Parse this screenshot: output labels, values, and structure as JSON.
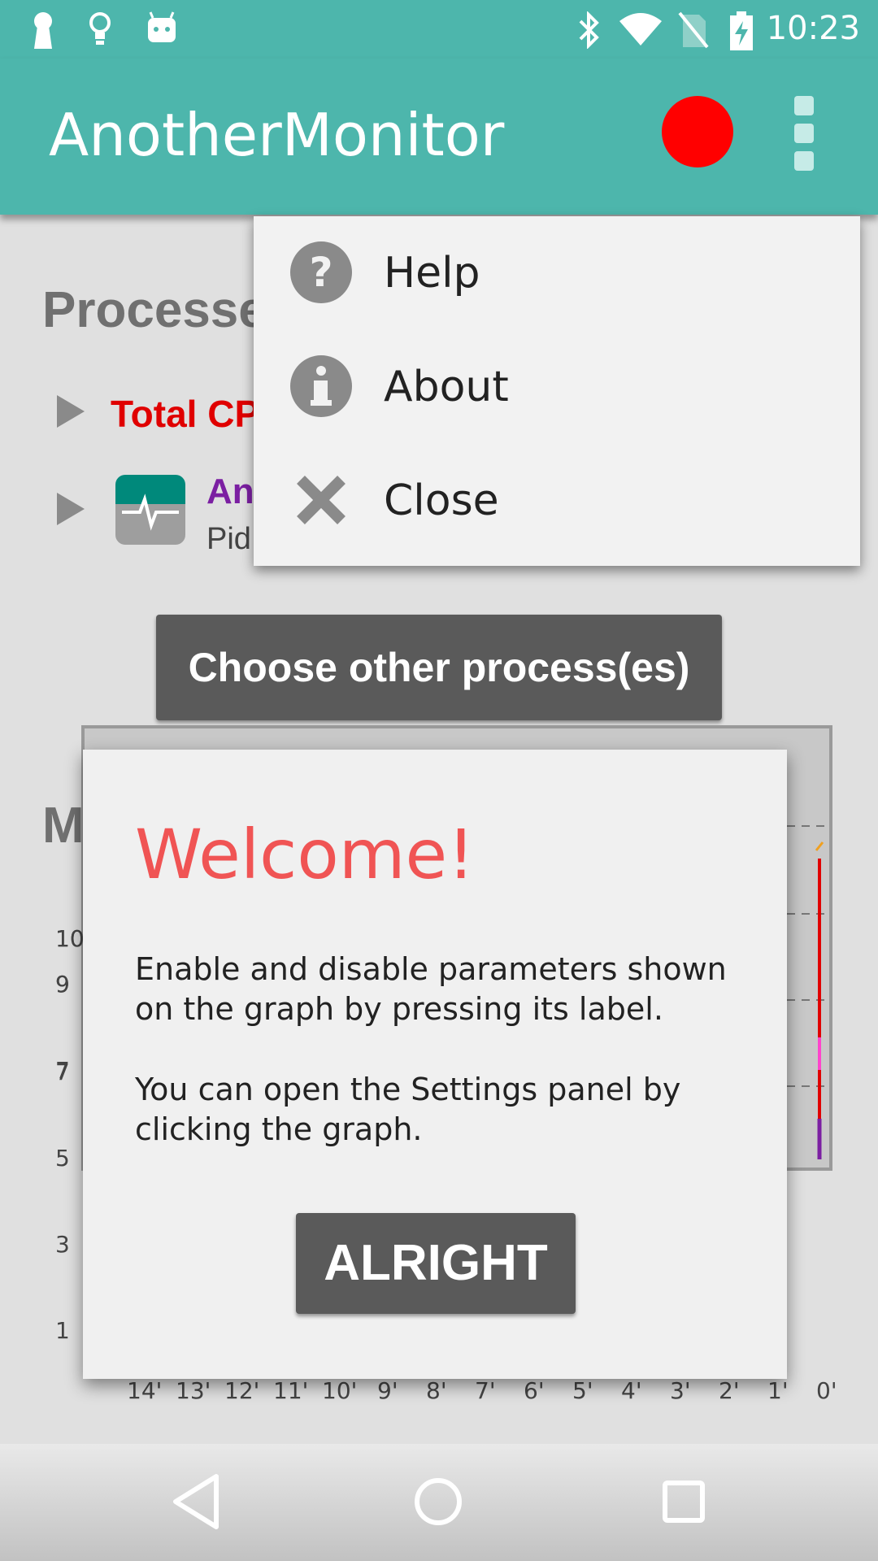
{
  "status_bar": {
    "time": "10:23",
    "left_icons": [
      "keyhole-icon",
      "lightbulb-icon",
      "android-icon"
    ],
    "right_icons": [
      "bluetooth-icon",
      "wifi-icon",
      "no-sim-icon",
      "battery-charging-icon"
    ]
  },
  "app_bar": {
    "title": "AnotherMonitor",
    "record_color": "#ff0000",
    "accent_color": "#4db6ac"
  },
  "background": {
    "processes_title": "Processe",
    "total_cpu_label": "Total CP",
    "process_name": "An",
    "process_pid_label": "Pid",
    "choose_button": "Choose other process(es)",
    "memory_title": "M",
    "y_ticks": [
      "10",
      "9",
      "7",
      "5",
      "3",
      "1"
    ],
    "x_ticks": [
      "14'",
      "13'",
      "12'",
      "11'",
      "10'",
      "9'",
      "8'",
      "7'",
      "6'",
      "5'",
      "4'",
      "3'",
      "2'",
      "1'",
      "0'"
    ]
  },
  "menu": {
    "items": [
      {
        "label": "Help",
        "icon": "help-icon"
      },
      {
        "label": "About",
        "icon": "info-icon"
      },
      {
        "label": "Close",
        "icon": "close-icon"
      }
    ]
  },
  "dialog": {
    "title": "Welcome!",
    "paragraph_1": "Enable and disable parameters shown on the graph by pressing its label.",
    "paragraph_2": "You can open the Settings panel by clicking the graph.",
    "button": "ALRIGHT",
    "title_color": "#f05454"
  },
  "nav_bar": {
    "buttons": [
      "back-icon",
      "home-icon",
      "recents-icon"
    ]
  }
}
